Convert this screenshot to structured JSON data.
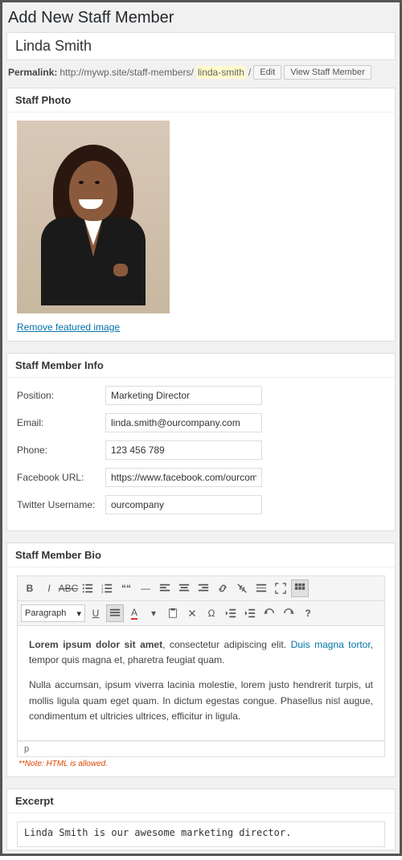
{
  "page": {
    "title": "Add New Staff Member"
  },
  "post": {
    "title": "Linda Smith"
  },
  "permalink": {
    "label": "Permalink:",
    "base": "http://mywp.site/staff-members/",
    "slug": "linda-smith",
    "trail": "/",
    "edit_btn": "Edit",
    "view_btn": "View Staff Member"
  },
  "photo": {
    "heading": "Staff Photo",
    "remove_link": "Remove featured image"
  },
  "info": {
    "heading": "Staff Member Info",
    "fields": {
      "position": {
        "label": "Position:",
        "value": "Marketing Director"
      },
      "email": {
        "label": "Email:",
        "value": "linda.smith@ourcompany.com"
      },
      "phone": {
        "label": "Phone:",
        "value": "123 456 789"
      },
      "facebook": {
        "label": "Facebook URL:",
        "value": "https://www.facebook.com/ourcompany"
      },
      "twitter": {
        "label": "Twitter Username:",
        "value": "ourcompany"
      }
    }
  },
  "bio": {
    "heading": "Staff Member Bio",
    "format_dropdown": "Paragraph",
    "para1_strong": "Lorem ipsum dolor sit amet",
    "para1_a": ", consectetur adipiscing elit. ",
    "para1_link": "Duis magna tortor",
    "para1_b": ", tempor quis magna et, pharetra feugiat quam.",
    "para2": "Nulla accumsan, ipsum viverra lacinia molestie, lorem justo hendrerit turpis, ut mollis ligula quam eget quam. In dictum egestas congue. Phasellus nisl augue, condimentum et ultricies ultrices, efficitur in ligula.",
    "path": "p",
    "note": "**Note: HTML is allowed."
  },
  "excerpt": {
    "heading": "Excerpt",
    "value": "Linda Smith is our awesome marketing director."
  }
}
